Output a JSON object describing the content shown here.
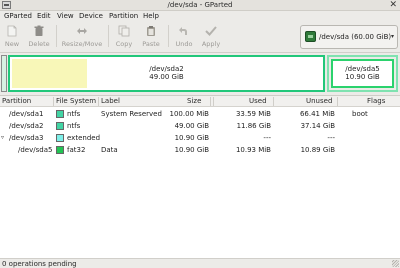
{
  "window": {
    "title": "/dev/sda - GParted",
    "close_glyph": "✕"
  },
  "menubar": {
    "items": [
      "GParted",
      "Edit",
      "View",
      "Device",
      "Partition",
      "Help"
    ]
  },
  "toolbar": {
    "new_label": "New",
    "delete_label": "Delete",
    "resize_label": "Resize/Move",
    "copy_label": "Copy",
    "paste_label": "Paste",
    "undo_label": "Undo",
    "apply_label": "Apply",
    "device_selector": "/dev/sda (60.00 GiB)",
    "device_arrow": "▾"
  },
  "diskmap": {
    "sda2": {
      "name": "/dev/sda2",
      "size": "49.00 GiB",
      "used_fraction": 0.24
    },
    "sda5": {
      "name": "/dev/sda5",
      "size": "10.90 GiB"
    }
  },
  "table": {
    "headers": [
      "Partition",
      "File System",
      "Label",
      "Size",
      "Used",
      "Unused",
      "Flags"
    ],
    "rows": [
      {
        "partition": "/dev/sda1",
        "fs": "ntfs",
        "fs_color": "#42d4a4",
        "label": "System Reserved",
        "size": "100.00 MiB",
        "used": "33.59 MiB",
        "unused": "66.41 MiB",
        "flags": "boot",
        "indent": 0,
        "expander": ""
      },
      {
        "partition": "/dev/sda2",
        "fs": "ntfs",
        "fs_color": "#42d4a4",
        "label": "",
        "size": "49.00 GiB",
        "used": "11.86 GiB",
        "unused": "37.14 GiB",
        "flags": "",
        "indent": 0,
        "expander": ""
      },
      {
        "partition": "/dev/sda3",
        "fs": "extended",
        "fs_color": "#7ef0e9",
        "label": "",
        "size": "10.90 GiB",
        "used": "---",
        "unused": "---",
        "flags": "",
        "indent": 0,
        "expander": "▿"
      },
      {
        "partition": "/dev/sda5",
        "fs": "fat32",
        "fs_color": "#22c454",
        "label": "Data",
        "size": "10.90 GiB",
        "used": "10.93 MiB",
        "unused": "10.89 GiB",
        "flags": "",
        "indent": 1,
        "expander": ""
      }
    ]
  },
  "statusbar": {
    "text": "0 operations pending"
  }
}
